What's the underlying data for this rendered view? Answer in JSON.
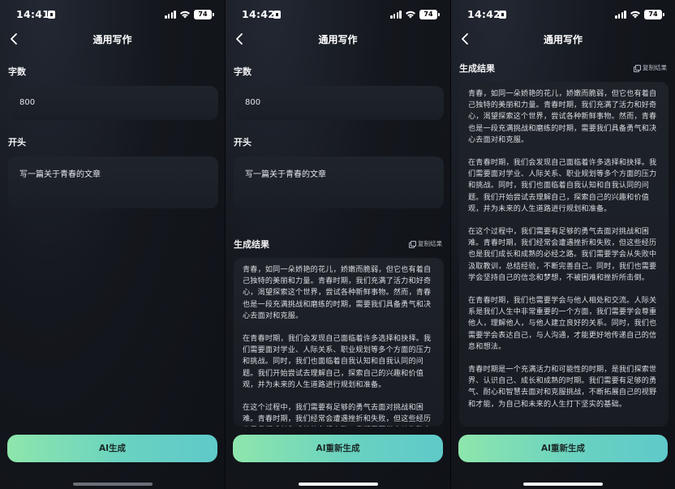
{
  "status": {
    "time": "14:41",
    "battery": "74"
  },
  "status2": {
    "time": "14:42",
    "battery": "74"
  },
  "status3": {
    "time": "14:42",
    "battery": "74"
  },
  "nav_title": "通用写作",
  "form": {
    "word_count_label": "字数",
    "word_count_value": "800",
    "opening_label": "开头",
    "opening_value": "写一篇关于青春的文章"
  },
  "result": {
    "label": "生成结果",
    "copy_label": "复制结果",
    "paragraphs": [
      "青春，如同一朵娇艳的花儿，娇嫩而脆弱，但它也有着自己独特的美丽和力量。青春时期，我们充满了活力和好奇心，渴望探索这个世界，尝试各种新鲜事物。然而，青春也是一段充满挑战和磨练的时期，需要我们具备勇气和决心去面对和克服。",
      "在青春时期，我们会发现自己面临着许多选择和抉择。我们需要面对学业、人际关系、职业规划等多个方面的压力和挑战。同时，我们也面临着自我认知和自我认同的问题。我们开始尝试去理解自己，探索自己的兴趣和价值观，并为未来的人生道路进行规划和准备。",
      "在这个过程中，我们需要有足够的勇气去面对挑战和困难。青春时期，我们经常会遭遇挫折和失败，但这些经历也是我们成长和成熟的必经之路。我们需要学会从失败中汲取教训，总结经验，不断完善自己。同时，我们也需要学会坚持自己的信念和梦想，不被困难和挫折所击倒。",
      "在青春时期，我们也需要学会与他人相处和交流。人际关系是我们人生中非常重要的一个方面，我们需要学会尊重他人，理解他人，与他人建立良好的关系。同时，我们也需要学会表达自己，与人沟通，才能更好地传递自己的信息和想法。",
      "青春时期是一个充满活力和可能性的时期，是我们探索世界、认识自己、成长和成熟的时期。我们需要有足够的勇气、耐心和智慧去面对和克服挑战，不断拓展自己的视野和才能，为自己和未来的人生打下坚实的基础。"
    ]
  },
  "buttons": {
    "generate": "AI生成",
    "regenerate": "AI重新生成"
  },
  "colors": {
    "accent_start": "#8ee6ac",
    "accent_end": "#5fc9c9",
    "background": "#14171d",
    "card": "#1e2229"
  }
}
